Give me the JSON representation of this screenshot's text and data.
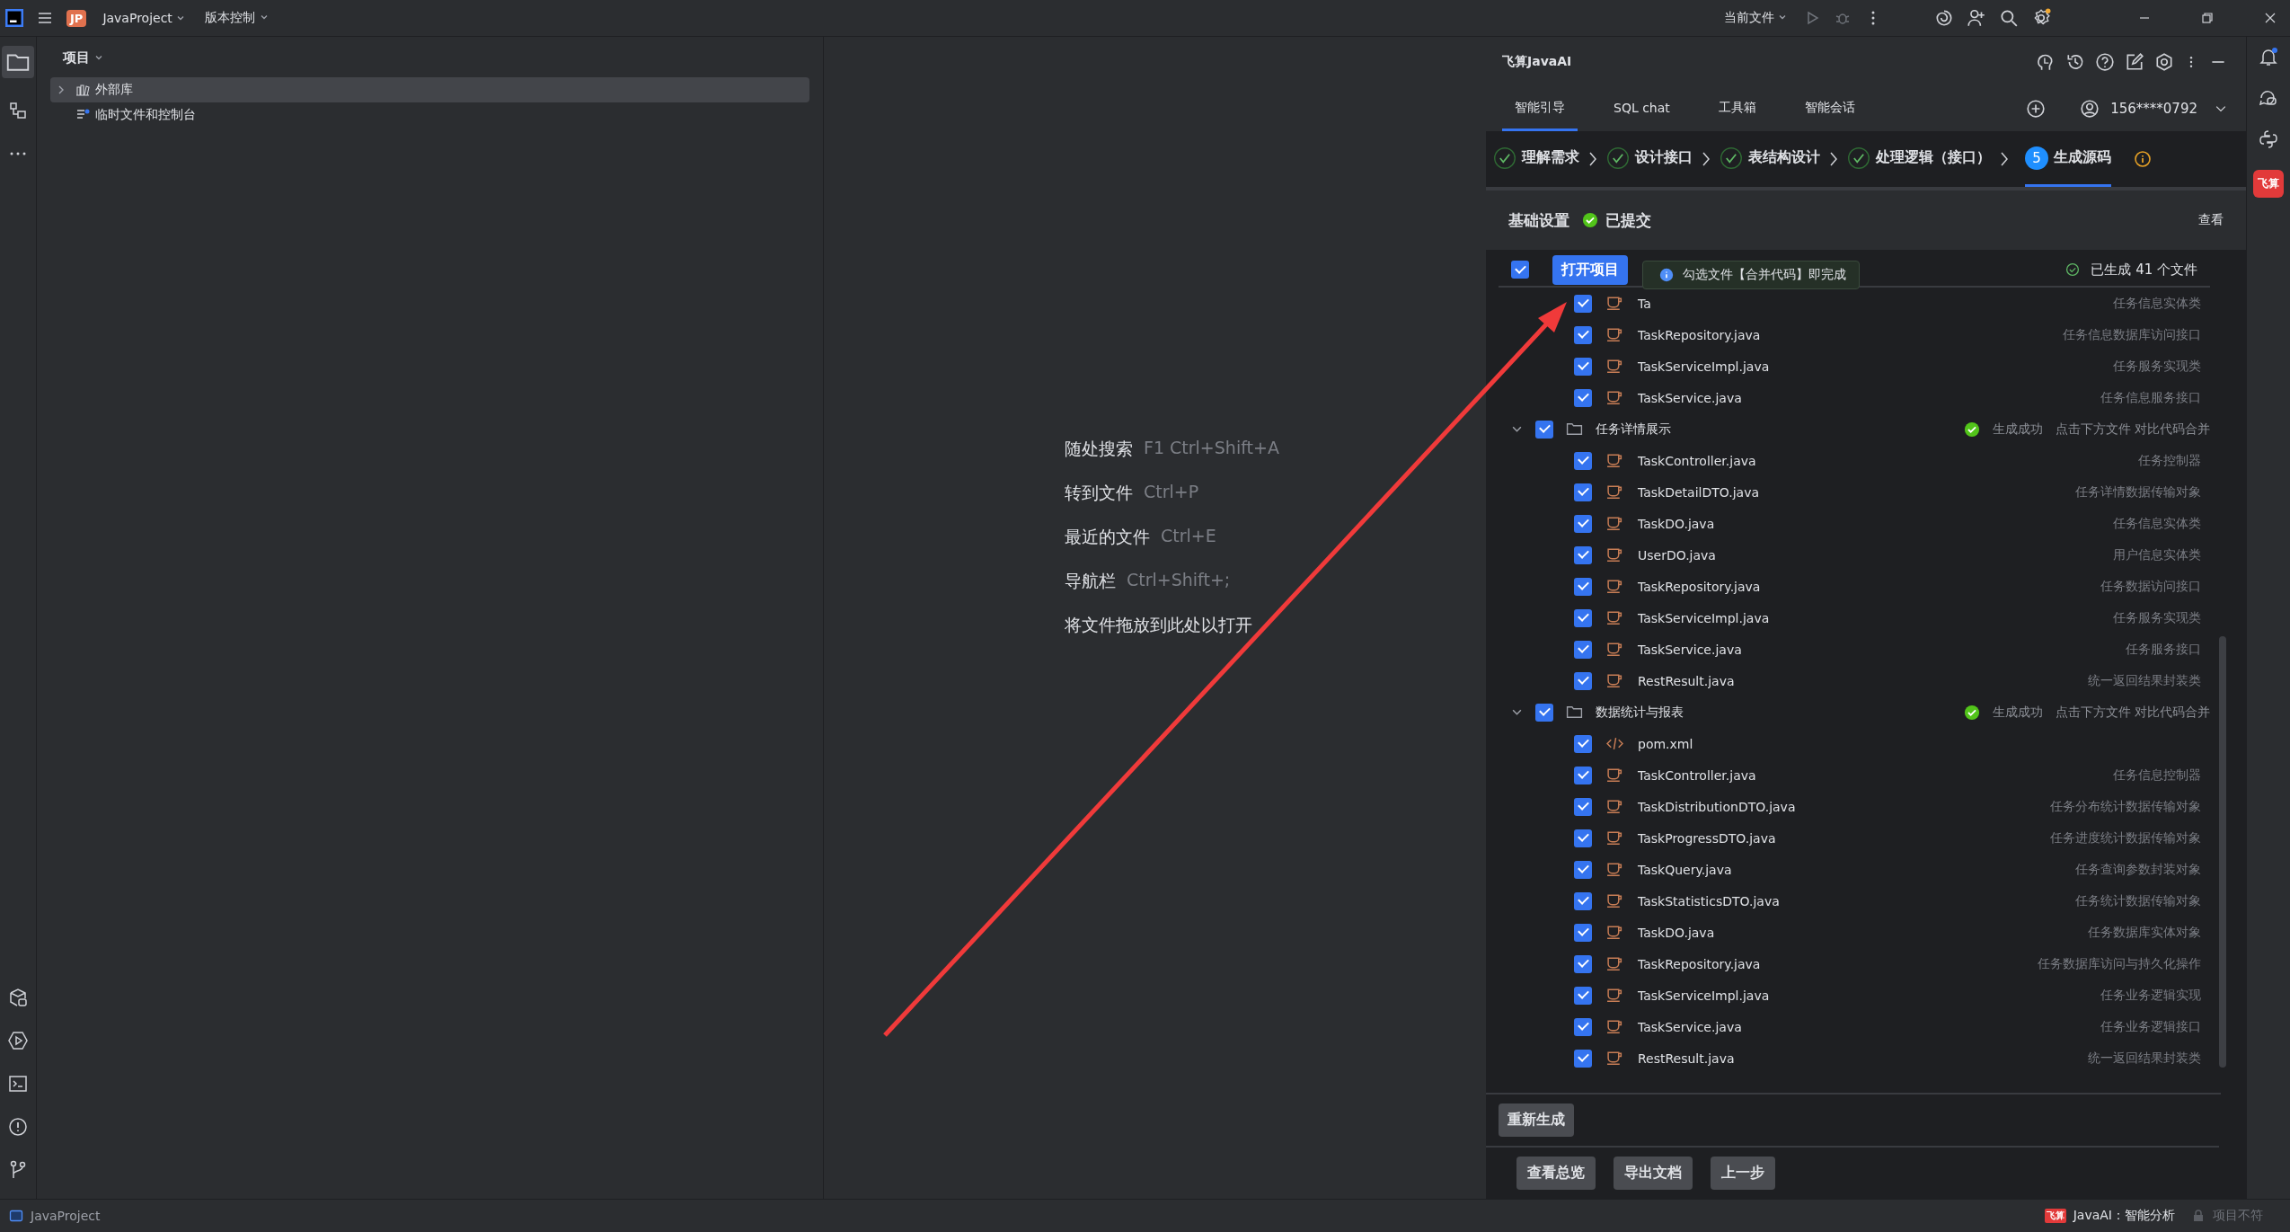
{
  "titlebar": {
    "project_badge": "JP",
    "project": "JavaProject",
    "vcs": "版本控制",
    "run_config": "当前文件"
  },
  "project_panel": {
    "title": "项目",
    "tree": [
      {
        "label": "外部库",
        "kind": "folder",
        "expanded": false,
        "selected": true
      },
      {
        "label": "临时文件和控制台",
        "kind": "leaf",
        "selected": false
      }
    ]
  },
  "editor_hints": [
    {
      "action": "随处搜索",
      "shortcut": "F1 Ctrl+Shift+A"
    },
    {
      "action": "转到文件",
      "shortcut": "Ctrl+P"
    },
    {
      "action": "最近的文件",
      "shortcut": "Ctrl+E"
    },
    {
      "action": "导航栏",
      "shortcut": "Ctrl+Shift+;"
    },
    {
      "action": "将文件拖放到此处以打开"
    }
  ],
  "ai_panel": {
    "title": "飞算JavaAI",
    "tabs": [
      {
        "label": "智能引导",
        "selected": true
      },
      {
        "label": "SQL chat",
        "selected": false
      },
      {
        "label": "工具箱",
        "selected": false
      },
      {
        "label": "智能会话",
        "selected": false
      }
    ],
    "account": "156****0792",
    "steps": [
      {
        "label": "理解需求",
        "done": true,
        "selected": false
      },
      {
        "label": "设计接口",
        "done": true,
        "selected": false
      },
      {
        "label": "表结构设计",
        "done": true,
        "selected": false
      },
      {
        "label": "处理逻辑（接口）",
        "done": true,
        "selected": false
      },
      {
        "number": "5",
        "label": "生成源码",
        "done": false,
        "selected": true
      }
    ],
    "settings": {
      "label": "基础设置",
      "status": "已提交",
      "link": "查看"
    },
    "list_header": {
      "checked": true,
      "button": "打开项目",
      "summary": "已生成 41 个文件"
    },
    "tooltip": "勾选文件【合并代码】即完成",
    "groups": [
      {
        "files": [
          {
            "name": "Ta",
            "kind": "java",
            "checked": true,
            "desc": "任务信息实体类"
          },
          {
            "name": "TaskRepository.java",
            "kind": "java",
            "checked": true,
            "desc": "任务信息数据库访问接口"
          },
          {
            "name": "TaskServiceImpl.java",
            "kind": "java",
            "checked": true,
            "desc": "任务服务实现类"
          },
          {
            "name": "TaskService.java",
            "kind": "java",
            "checked": true,
            "desc": "任务信息服务接口"
          }
        ]
      },
      {
        "name": "任务详情展示",
        "expanded": true,
        "checked": true,
        "status": "生成成功",
        "hint": "点击下方文件 对比代码合并",
        "files": [
          {
            "name": "TaskController.java",
            "kind": "java",
            "checked": true,
            "desc": "任务控制器"
          },
          {
            "name": "TaskDetailDTO.java",
            "kind": "java",
            "checked": true,
            "desc": "任务详情数据传输对象"
          },
          {
            "name": "TaskDO.java",
            "kind": "java",
            "checked": true,
            "desc": "任务信息实体类"
          },
          {
            "name": "UserDO.java",
            "kind": "java",
            "checked": true,
            "desc": "用户信息实体类"
          },
          {
            "name": "TaskRepository.java",
            "kind": "java",
            "checked": true,
            "desc": "任务数据访问接口"
          },
          {
            "name": "TaskServiceImpl.java",
            "kind": "java",
            "checked": true,
            "desc": "任务服务实现类"
          },
          {
            "name": "TaskService.java",
            "kind": "java",
            "checked": true,
            "desc": "任务服务接口"
          },
          {
            "name": "RestResult.java",
            "kind": "java",
            "checked": true,
            "desc": "统一返回结果封装类"
          }
        ]
      },
      {
        "name": "数据统计与报表",
        "expanded": true,
        "checked": true,
        "status": "生成成功",
        "hint": "点击下方文件 对比代码合并",
        "files": [
          {
            "name": "pom.xml",
            "kind": "xml",
            "checked": true
          },
          {
            "name": "TaskController.java",
            "kind": "java",
            "checked": true,
            "desc": "任务信息控制器"
          },
          {
            "name": "TaskDistributionDTO.java",
            "kind": "java",
            "checked": true,
            "desc": "任务分布统计数据传输对象"
          },
          {
            "name": "TaskProgressDTO.java",
            "kind": "java",
            "checked": true,
            "desc": "任务进度统计数据传输对象"
          },
          {
            "name": "TaskQuery.java",
            "kind": "java",
            "checked": true,
            "desc": "任务查询参数封装对象"
          },
          {
            "name": "TaskStatisticsDTO.java",
            "kind": "java",
            "checked": true,
            "desc": "任务统计数据传输对象"
          },
          {
            "name": "TaskDO.java",
            "kind": "java",
            "checked": true,
            "desc": "任务数据库实体对象"
          },
          {
            "name": "TaskRepository.java",
            "kind": "java",
            "checked": true,
            "desc": "任务数据库访问与持久化操作"
          },
          {
            "name": "TaskServiceImpl.java",
            "kind": "java",
            "checked": true,
            "desc": "任务业务逻辑实现"
          },
          {
            "name": "TaskService.java",
            "kind": "java",
            "checked": true,
            "desc": "任务业务逻辑接口"
          },
          {
            "name": "RestResult.java",
            "kind": "java",
            "checked": true,
            "desc": "统一返回结果封装类"
          }
        ]
      }
    ],
    "regenerate": "重新生成",
    "footer_buttons": [
      "查看总览",
      "导出文档",
      "上一步"
    ]
  },
  "side_logo": "飞算",
  "status_bar": {
    "project": "JavaProject",
    "logo": "飞算",
    "ai_status": "JavaAI：智能分析",
    "lock_text": "项目不符"
  }
}
